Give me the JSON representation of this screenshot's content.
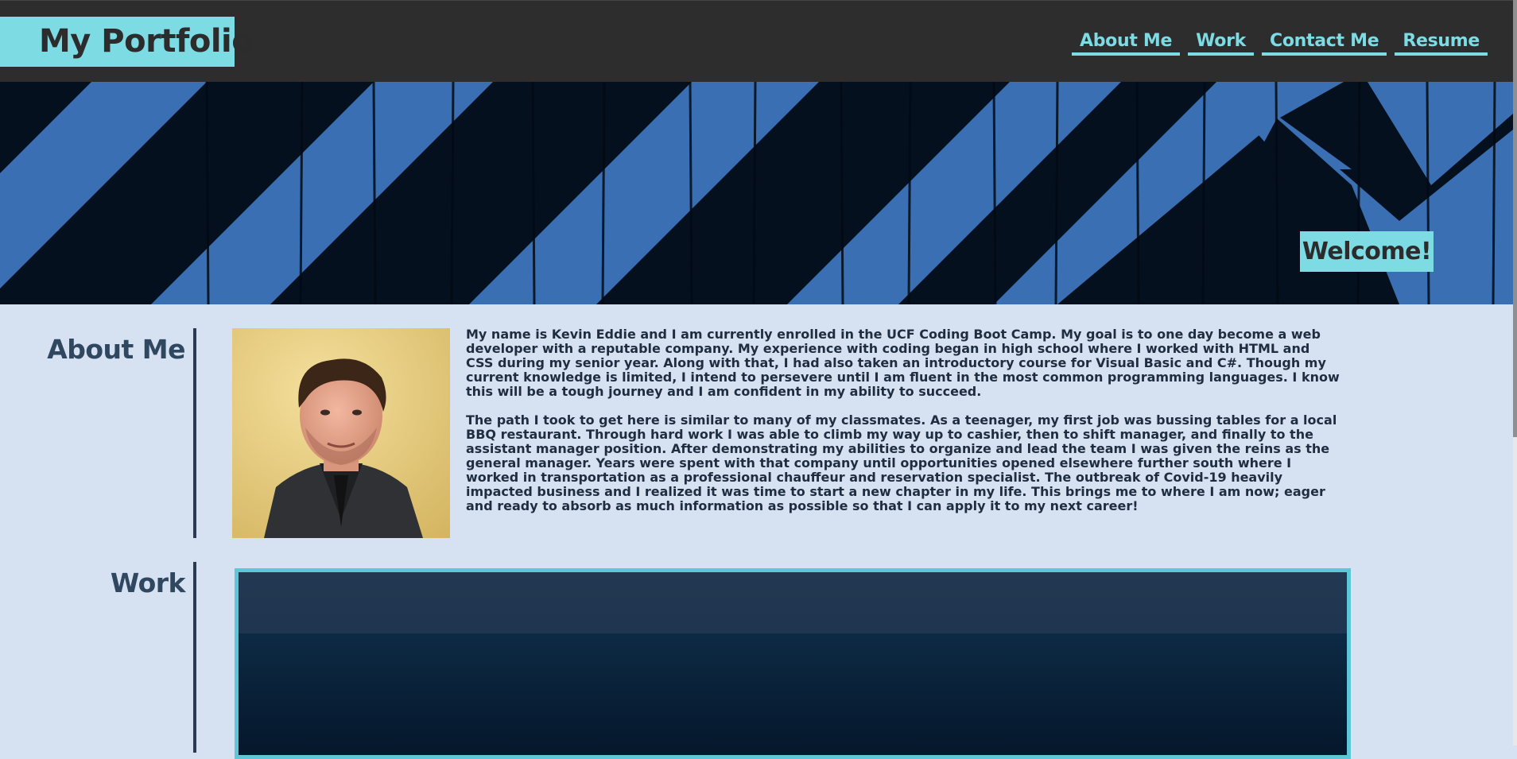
{
  "header": {
    "brand": "My Portfolio",
    "nav": [
      {
        "label": "About Me"
      },
      {
        "label": "Work"
      },
      {
        "label": "Contact Me"
      },
      {
        "label": "Resume"
      }
    ]
  },
  "hero": {
    "welcome": "Welcome!"
  },
  "about": {
    "title": "About Me",
    "paragraphs": [
      "My name is Kevin Eddie and I am currently enrolled in the UCF Coding Boot Camp. My goal is to one day become a web developer with a reputable company. My experience with coding began in high school where I worked with HTML and CSS during my senior year. Along with that, I had also taken an introductory course for Visual Basic and C#. Though my current knowledge is limited, I intend to persevere until I am fluent in the most common programming languages. I know this will be a tough journey and I am confident in my ability to succeed.",
      "The path I took to get here is similar to many of my classmates. As a teenager, my first job was bussing tables for a local BBQ restaurant. Through hard work I was able to climb my way up to cashier, then to shift manager, and finally to the assistant manager position. After demonstrating my abilities to organize and lead the team I was given the reins as the general manager. Years were spent with that company until opportunities opened elsewhere further south where I worked in transportation as a professional chauffeur and reservation specialist. The outbreak of Covid-19 heavily impacted business and I realized it was time to start a new chapter in my life. This brings me to where I am now; eager and ready to absorb as much information as possible so that I can apply it to my next career!"
    ]
  },
  "work": {
    "title": "Work"
  },
  "colors": {
    "accent": "#7ddbe4",
    "header_bg": "#2d2d2d",
    "page_bg": "#d6e1f1",
    "heading": "#304760",
    "stripe_blue": "#3a70b3"
  }
}
